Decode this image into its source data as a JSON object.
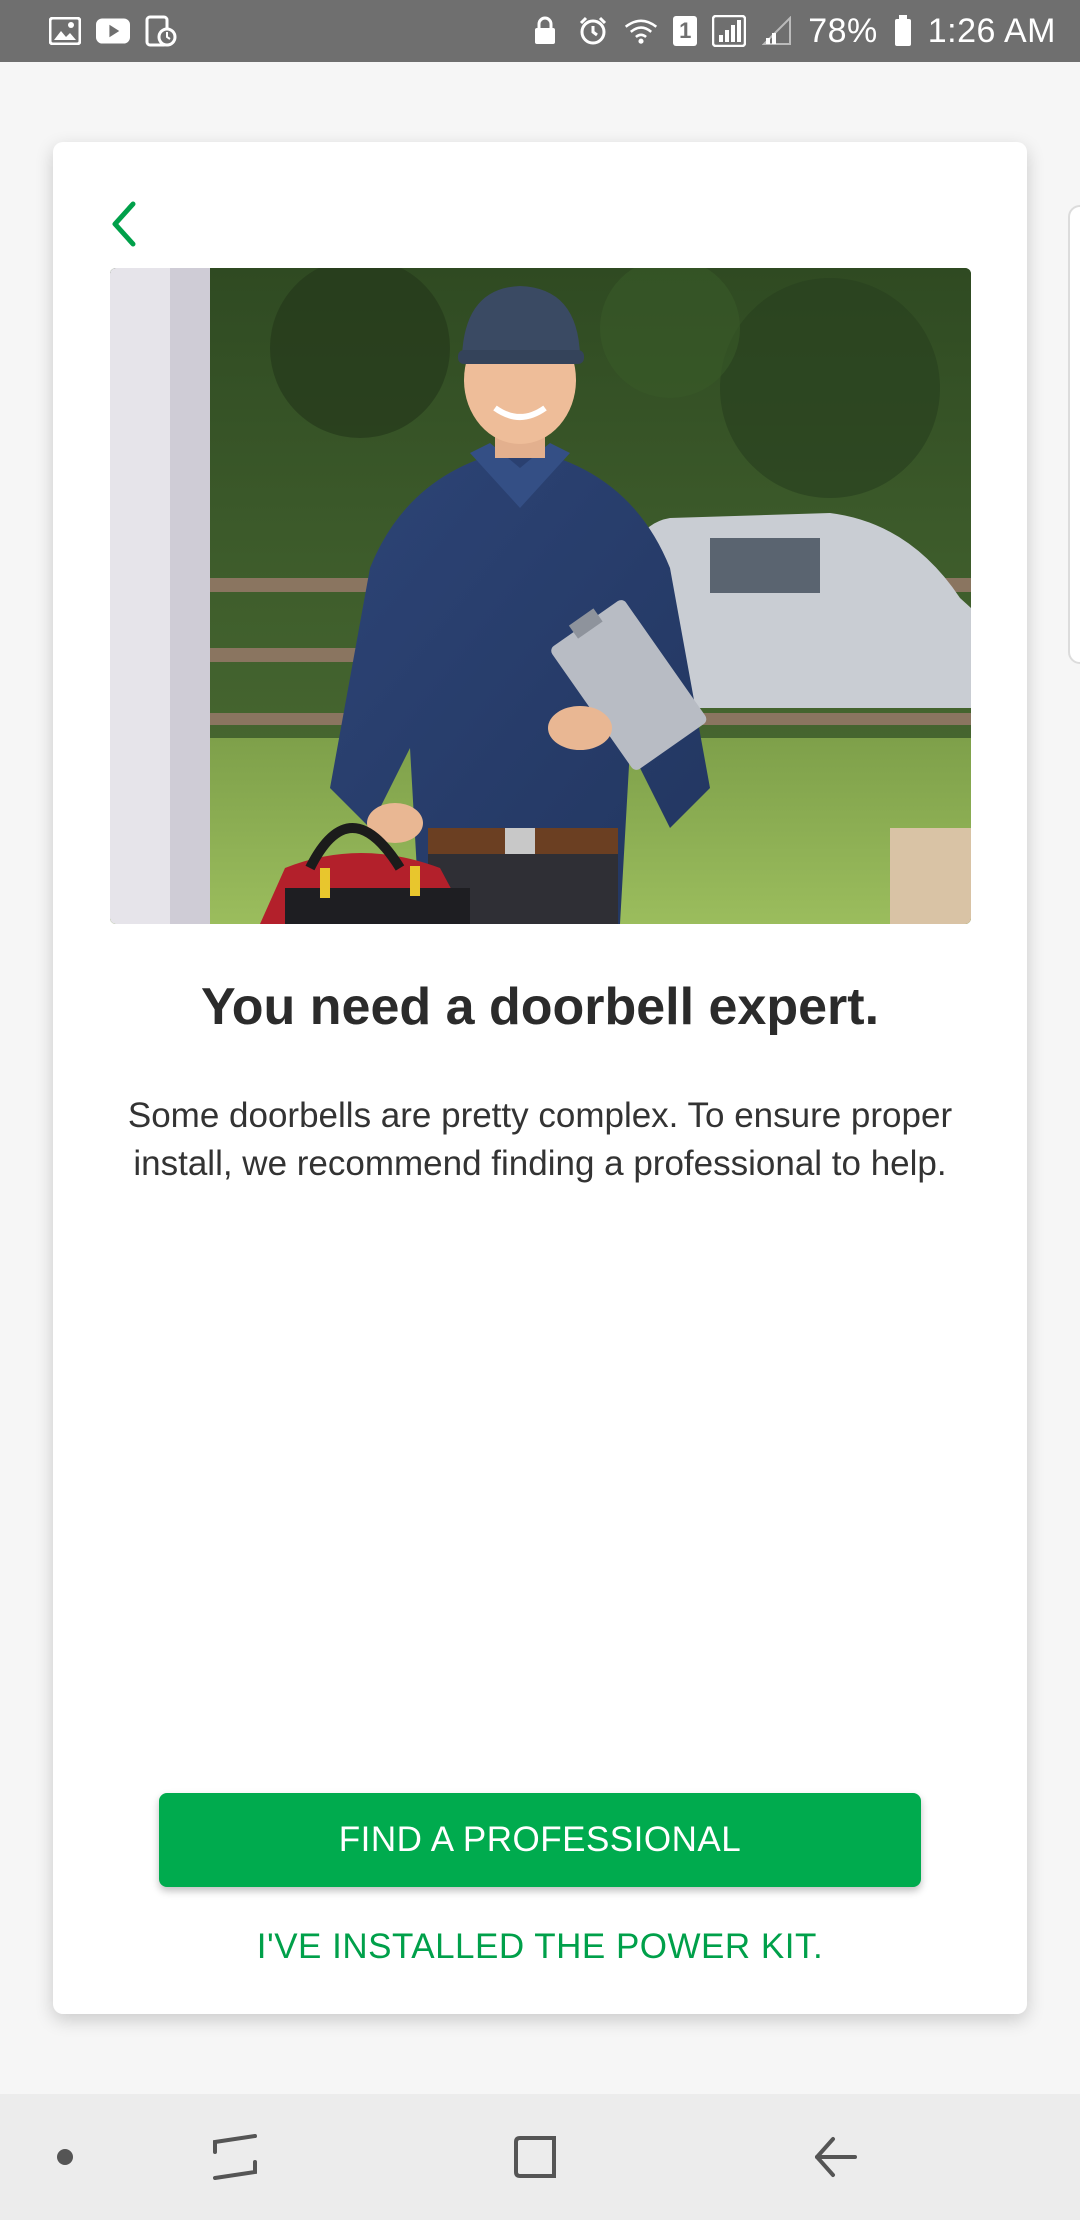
{
  "status_bar": {
    "battery_percent": "78%",
    "time": "1:26 AM",
    "left_icons": [
      "gallery-icon",
      "youtube-icon",
      "screen-recorder-icon"
    ],
    "right_icons": [
      "lock-icon",
      "alarm-icon",
      "wifi-icon",
      "sim1-icon",
      "signal-icon",
      "signal-weak-icon",
      "battery-icon"
    ],
    "sim_label": "1"
  },
  "card": {
    "back_icon": "chevron-left-icon",
    "hero_image": "technician-photo",
    "headline": "You need a doorbell expert.",
    "body": "Some doorbells are pretty complex. To ensure proper install, we recommend finding a professional to help.",
    "primary_button": "FIND A PROFESSIONAL",
    "secondary_link": "I'VE INSTALLED THE POWER KIT."
  },
  "colors": {
    "accent_green": "#00ab4e",
    "link_green": "#00a04a",
    "status_bar": "#6f6f6f"
  },
  "nav_bar": {
    "items": [
      "dot-icon",
      "recents-icon",
      "home-icon",
      "back-icon"
    ]
  }
}
